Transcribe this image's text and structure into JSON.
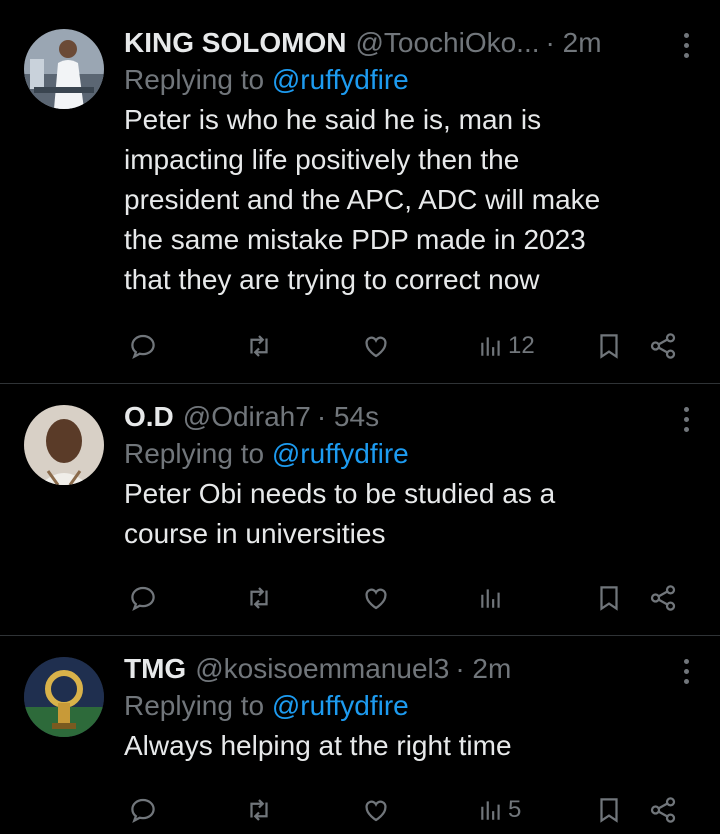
{
  "tweets": [
    {
      "name": "KING SOLOMON",
      "handle": "@ToochiOko...",
      "time": "· 2m",
      "replying_prefix": "Replying to",
      "replying_to": "@ruffydfire",
      "body_lines": [
        "Peter is who he said he is, man is",
        "impacting life positively then the",
        "president and the APC, ADC will make",
        "the same mistake PDP made in 2023",
        "that they are trying to correct now"
      ],
      "views": "12",
      "avatar_color": "#cfd6df"
    },
    {
      "name": "O.D",
      "handle": "@Odirah7",
      "time": "· 54s",
      "replying_prefix": "Replying to",
      "replying_to": "@ruffydfire",
      "body_lines": [
        "Peter Obi needs to be studied as a",
        "course in universities"
      ],
      "views": "",
      "avatar_color": "#7a5a45"
    },
    {
      "name": "TMG",
      "handle": "@kosisoemmanuel3",
      "time": "· 2m",
      "replying_prefix": "Replying to",
      "replying_to": "@ruffydfire",
      "body_lines": [
        "Always helping at the right time"
      ],
      "views": "5",
      "avatar_color": "#2a3a5a"
    }
  ],
  "icons": {
    "reply": "reply-icon",
    "retweet": "retweet-icon",
    "like": "like-icon",
    "views": "views-icon",
    "bookmark": "bookmark-icon",
    "share": "share-icon",
    "more": "more-icon"
  },
  "colors": {
    "background": "#000000",
    "text": "#e7e9ea",
    "muted": "#71767b",
    "link": "#1d9bf0",
    "divider": "#2f3336"
  }
}
